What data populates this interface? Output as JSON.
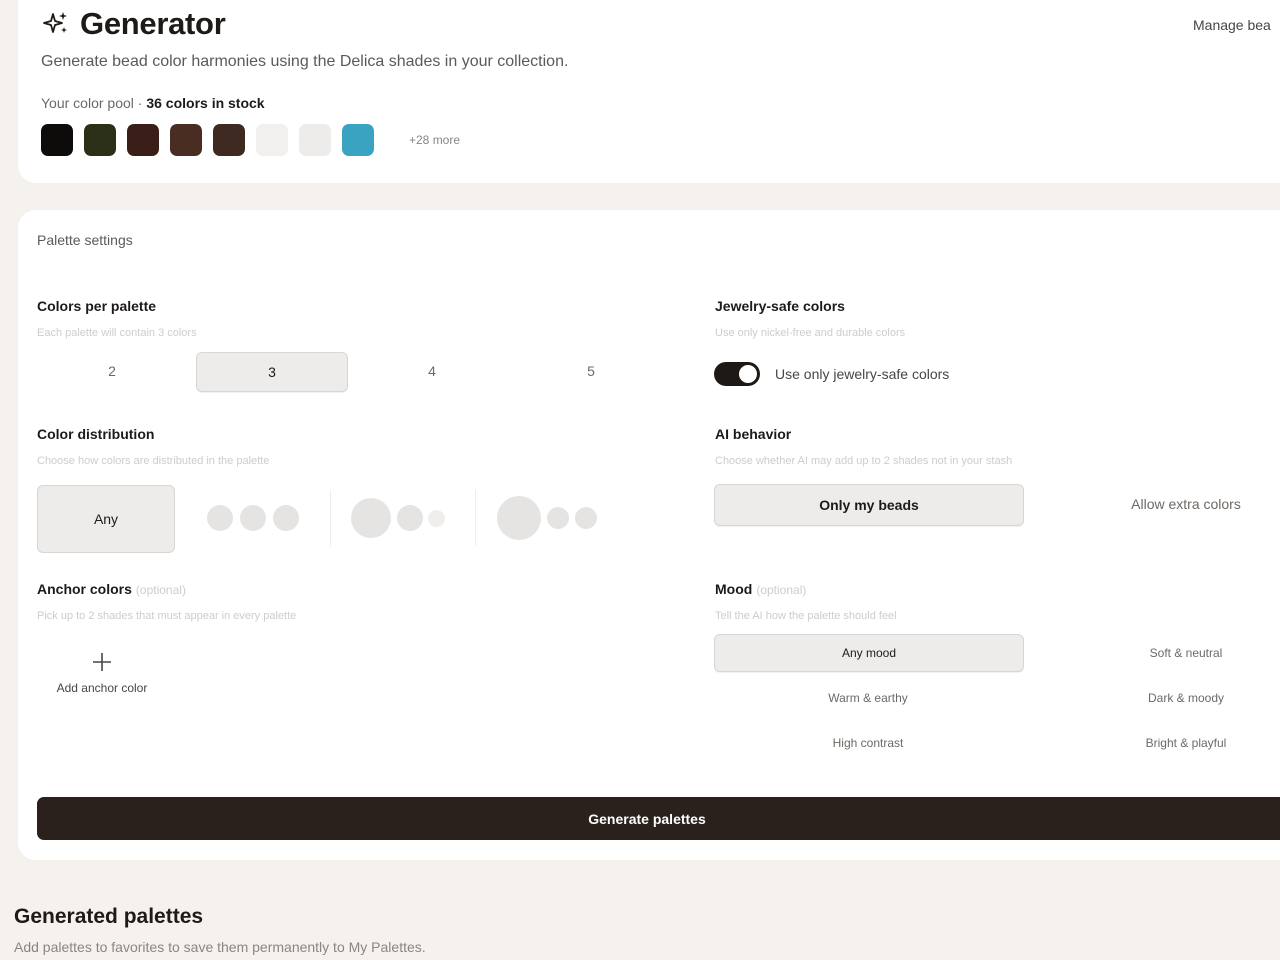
{
  "header": {
    "title": "Generator",
    "subtitle": "Generate bead color harmonies using the Delica shades in your collection.",
    "manage_link": "Manage bea"
  },
  "pool": {
    "label": "Your color pool ·",
    "count_text": "36 colors in stock",
    "swatches": [
      "#0e0c0b",
      "#2d3018",
      "#3a1f19",
      "#4a2d22",
      "#3e2a20",
      "#f2f0ee",
      "#eeeceb",
      "#3aa3c2"
    ],
    "more_text": "+28 more"
  },
  "settings": {
    "title": "Palette settings",
    "colors_per_palette": {
      "label": "Colors per palette",
      "hint": "Each palette will contain 3 colors",
      "options": [
        "2",
        "3",
        "4",
        "5"
      ],
      "selected": "3"
    },
    "jewelry_safe": {
      "label": "Jewelry-safe colors",
      "hint": "Use only nickel-free and durable colors",
      "toggle_label": "Use only jewelry-safe colors",
      "enabled": true
    },
    "distribution": {
      "label": "Color distribution",
      "hint": "Choose how colors are distributed in the palette",
      "any_label": "Any"
    },
    "ai_behavior": {
      "label": "AI behavior",
      "hint": "Choose whether AI may add up to 2 shades not in your stash",
      "options": [
        "Only my beads",
        "Allow extra colors"
      ],
      "selected": "Only my beads"
    },
    "anchor": {
      "label": "Anchor colors",
      "optional": "(optional)",
      "hint": "Pick up to 2 shades that must appear in every palette",
      "add_label": "Add anchor color"
    },
    "mood": {
      "label": "Mood",
      "optional": "(optional)",
      "hint": "Tell the AI how the palette should feel",
      "options": [
        "Any mood",
        "Soft & neutral",
        "Warm & earthy",
        "Dark & moody",
        "High contrast",
        "Bright & playful"
      ],
      "selected": "Any mood"
    },
    "generate_label": "Generate palettes"
  },
  "generated": {
    "title": "Generated palettes",
    "subtitle": "Add palettes to favorites to save them permanently to My Palettes."
  },
  "colors": {
    "accent_dark": "#2a211d",
    "page_bg": "#f5f2ee"
  },
  "icons": [
    "sparkle-icon",
    "plus-icon"
  ]
}
